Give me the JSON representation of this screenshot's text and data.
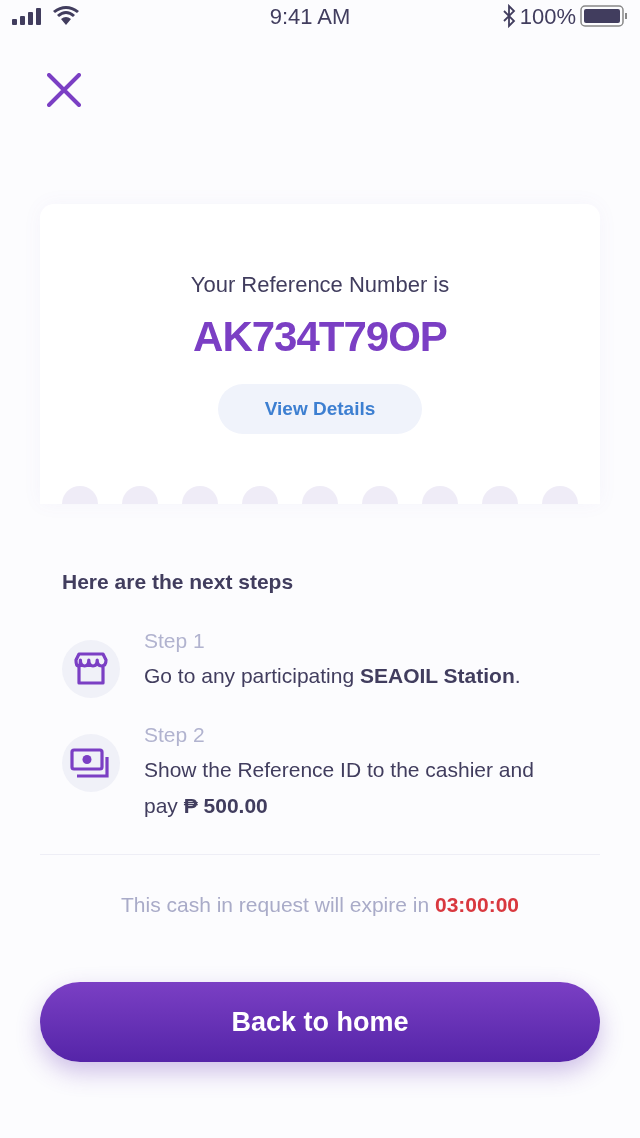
{
  "status_bar": {
    "time": "9:41 AM",
    "battery": "100%"
  },
  "reference": {
    "label": "Your Reference Number is",
    "number": "AK734T79OP",
    "details_button": "View Details"
  },
  "steps_heading": "Here are the next steps",
  "steps": [
    {
      "kind": "store",
      "title": "Step 1",
      "text": "Go to any participating **SEAOIL Station**."
    },
    {
      "kind": "cash",
      "title": "Step 2",
      "text": "Show the Reference ID to the cashier and pay **₱ 500.00**"
    }
  ],
  "expiry": {
    "text": "This cash in request will expire in",
    "timer": "03:00:00"
  },
  "home_button": "Back to home"
}
